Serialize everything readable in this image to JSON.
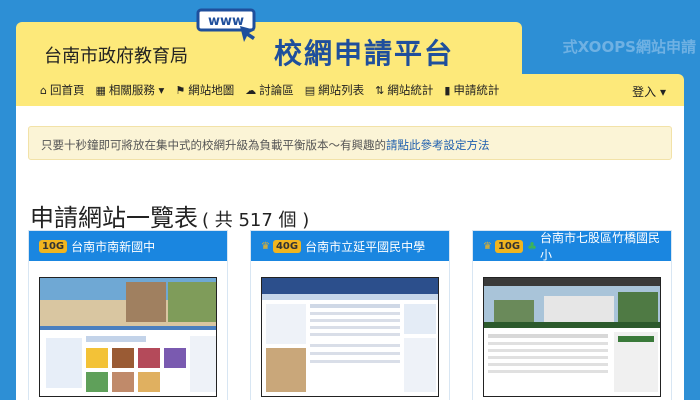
{
  "header": {
    "org_name": "台南市政府教育局",
    "site_title": "校網申請平台",
    "logo_text": "www",
    "bg_banner_text": "式XOOPS網站申請"
  },
  "nav": {
    "items": [
      {
        "icon": "home-icon",
        "glyph": "⌂",
        "label": "回首頁"
      },
      {
        "icon": "calendar-icon",
        "glyph": "▦",
        "label": "相關服務 ▾"
      },
      {
        "icon": "flag-icon",
        "glyph": "⚑",
        "label": "網站地圖"
      },
      {
        "icon": "comments-icon",
        "glyph": "☁",
        "label": "討論區"
      },
      {
        "icon": "list-icon",
        "glyph": "▤",
        "label": "網站列表"
      },
      {
        "icon": "sort-icon",
        "glyph": "⇅",
        "label": "網站統計"
      },
      {
        "icon": "chart-icon",
        "glyph": "▮",
        "label": "申請統計"
      }
    ],
    "login_label": "登入 ▾"
  },
  "notice": {
    "text": "只要十秒鐘即可將放在集中式的校網升級為負載平衡版本～有興趣的",
    "link": "請點此參考設定方法"
  },
  "heading": {
    "title": "申請網站一覽表",
    "count": "( 共 517 個 )"
  },
  "cards": [
    {
      "badge": "10G",
      "crown": false,
      "leaf": false,
      "name": "台南市南新國中"
    },
    {
      "badge": "40G",
      "crown": true,
      "leaf": false,
      "name": "台南市立延平國民中學"
    },
    {
      "badge": "10G",
      "crown": true,
      "leaf": true,
      "name": "台南市七股區竹橋國民小"
    }
  ]
}
